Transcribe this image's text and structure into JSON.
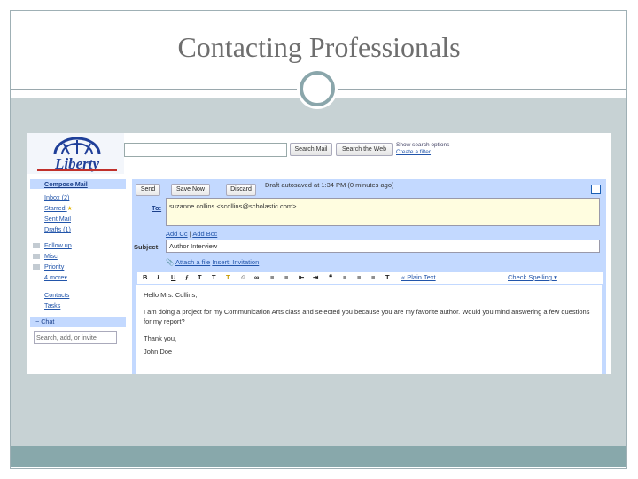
{
  "slide": {
    "title": "Contacting Professionals"
  },
  "colors": {
    "title_text": "#6e6e6e",
    "body_band": "#c7d2d4",
    "footer_band": "#88a8ab",
    "ring": "#8aa6ab",
    "compose_bg": "#c3d9ff"
  },
  "mail": {
    "logo_text": "Liberty",
    "search_mail_label": "Search Mail",
    "search_web_label": "Search the Web",
    "show_options_label": "Show search options",
    "create_filter_label": "Create a filter",
    "nav": {
      "compose": "Compose Mail",
      "items": [
        "Inbox (2)",
        "Starred",
        "Sent Mail",
        "Drafts (1)"
      ],
      "labels": [
        "Follow up",
        "Misc",
        "Priority",
        "4 more▾"
      ],
      "contacts": "Contacts",
      "tasks": "Tasks",
      "chat": "− Chat",
      "chat_search_placeholder": "Search, add, or invite"
    },
    "compose": {
      "send_label": "Send",
      "save_label": "Save Now",
      "discard_label": "Discard",
      "draft_status": "Draft autosaved at 1:34 PM (0 minutes ago)",
      "to_label": "To:",
      "to_value": "suzanne collins <scollins@scholastic.com>",
      "add_cc": "Add Cc",
      "separator": "|",
      "add_bcc": "Add Bcc",
      "subject_label": "Subject:",
      "subject_value": "Author Interview",
      "attach_label": "Attach a file",
      "insert_label": "Insert: Invitation",
      "plain_text_link": "« Plain Text",
      "spelling_link": "Check Spelling ▾",
      "body": {
        "greeting": "Hello Mrs. Collins,",
        "para1": "I am doing a project for my Communication Arts class and selected you because you are my favorite author. Would you mind answering a few questions for my report?",
        "thanks": "Thank you,",
        "signature": "John Doe"
      }
    }
  }
}
